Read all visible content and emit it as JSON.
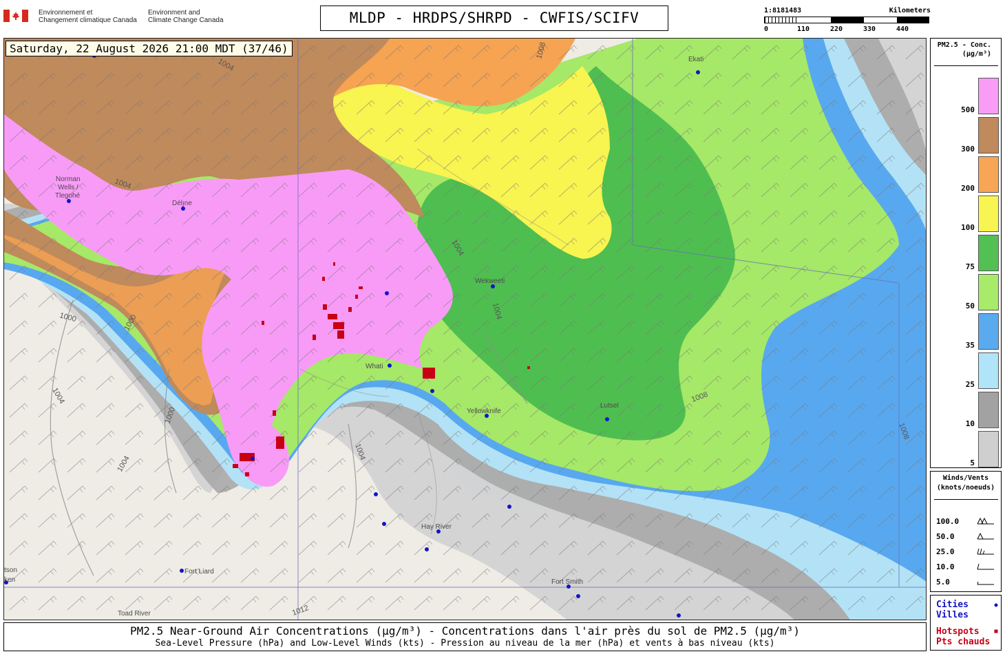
{
  "header": {
    "org_fr_1": "Environnement et",
    "org_fr_2": "Changement climatique Canada",
    "org_en_1": "Environment and",
    "org_en_2": "Climate Change Canada",
    "title": "MLDP - HRDPS/SHRPD - CWFIS/SCIFV"
  },
  "scale": {
    "ratio": "1:8181483",
    "unit": "Kilometers",
    "ticks": [
      "0",
      "110",
      "220",
      "330",
      "440"
    ]
  },
  "timestamp": "Saturday, 22 August 2026 21:00 MDT (37/46)",
  "legend_concentration": {
    "title_1": "PM2.5 - Conc.",
    "title_2": "(µg/m³)",
    "bins": [
      {
        "label": "500",
        "color": "#f89cf8"
      },
      {
        "label": "300",
        "color": "#c08a5c"
      },
      {
        "label": "200",
        "color": "#f8a555"
      },
      {
        "label": "100",
        "color": "#f8f552"
      },
      {
        "label": "75",
        "color": "#52c052"
      },
      {
        "label": "50",
        "color": "#a8ea6a"
      },
      {
        "label": "35",
        "color": "#5aaaf0"
      },
      {
        "label": "25",
        "color": "#b0e4f8"
      },
      {
        "label": "10",
        "color": "#a2a2a2"
      },
      {
        "label": "5",
        "color": "#cfcfcf"
      }
    ]
  },
  "legend_winds": {
    "title_1": "Winds/Vents",
    "title_2": "(knots/noeuds)",
    "rows": [
      "100.0",
      "50.0",
      "25.0",
      "10.0",
      "5.0"
    ]
  },
  "legend_points": {
    "cities_1": "Cities",
    "cities_2": "Villes",
    "hotspots_1": "Hotspots",
    "hotspots_2": "Pts chauds",
    "city_color": "#1414c8",
    "hotspot_color": "#c80014"
  },
  "map": {
    "cities": [
      "Norman",
      "Wells /",
      "Tlegohé",
      "Délı̨ne",
      "Whati",
      "Yellowknife",
      "Hay River",
      "Fort Liard",
      "Fort Smith",
      "Toad River",
      "Lutsel",
      "Wekweeti",
      "Ekati",
      "tson",
      "ken"
    ],
    "isobars": [
      "1004",
      "1004",
      "1000",
      "1000",
      "1004",
      "1004",
      "1000",
      "1004",
      "1008",
      "1004",
      "1008",
      "1008",
      "1012",
      "1004"
    ]
  },
  "footer": {
    "line1": "PM2.5 Near-Ground Air Concentrations (µg/m³) - Concentrations dans l'air près du sol de PM2.5 (µg/m³)",
    "line2": "Sea-Level Pressure (hPa) and Low-Level Winds (kts) - Pression au niveau de la mer (hPa) et vents à bas niveau (kts)"
  }
}
